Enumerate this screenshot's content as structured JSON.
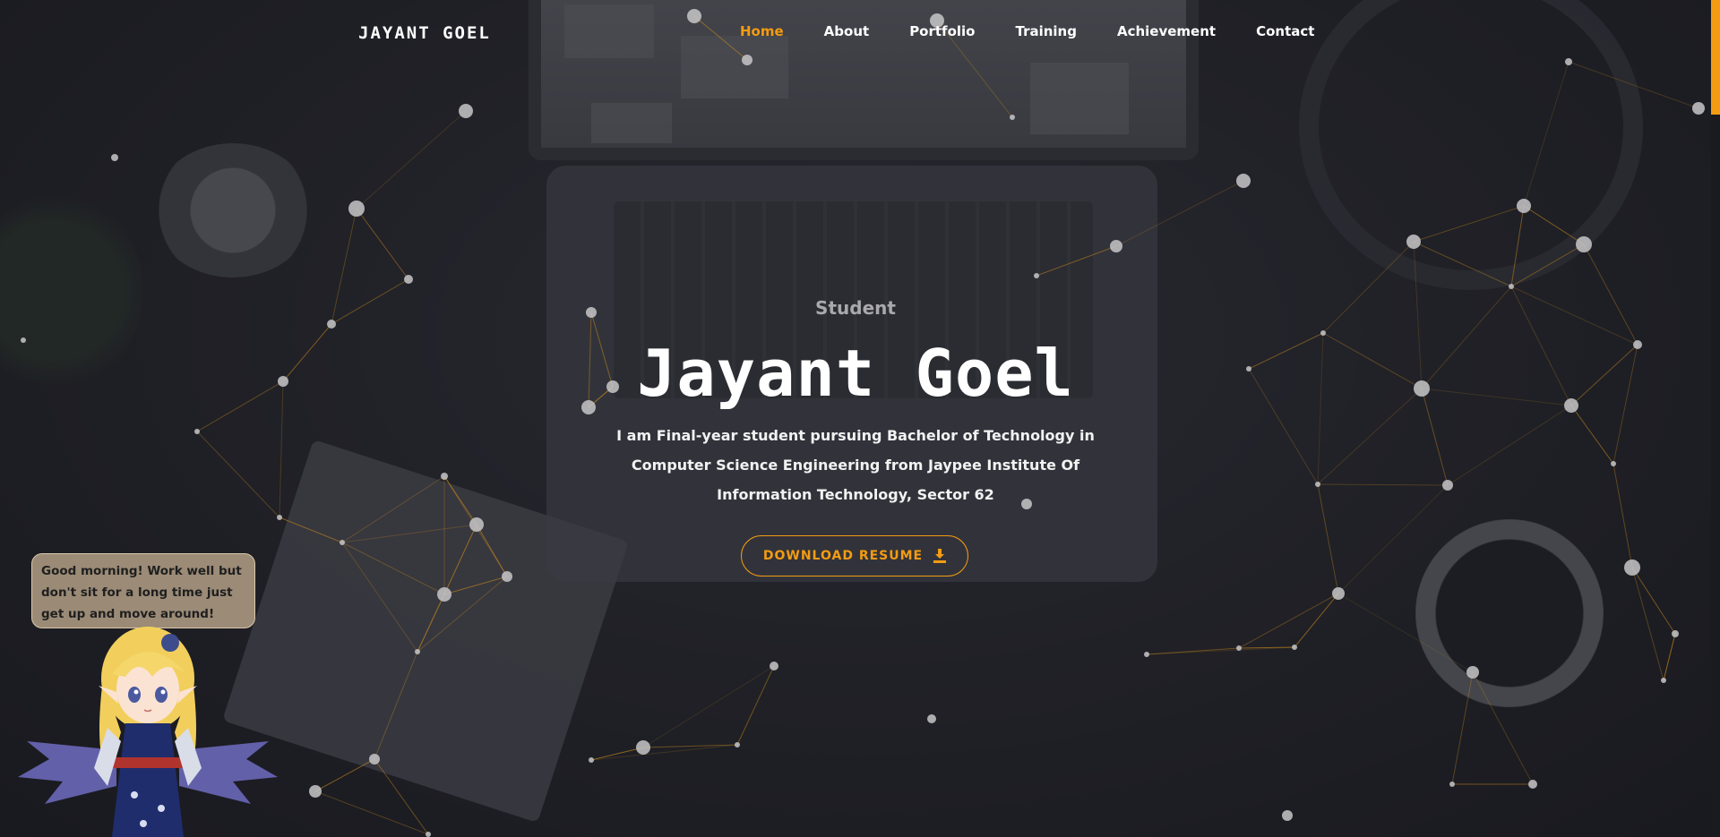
{
  "header": {
    "logo": "JAYANT GOEL",
    "nav": [
      {
        "label": "Home",
        "active": true
      },
      {
        "label": "About"
      },
      {
        "label": "Portfolio"
      },
      {
        "label": "Training"
      },
      {
        "label": "Achievement"
      },
      {
        "label": "Contact"
      }
    ]
  },
  "hero": {
    "eyebrow": "Student",
    "title": "Jayant Goel",
    "description": "I am Final-year student pursuing Bachelor of Technology in Computer Science Engineering from Jaypee Institute Of Information Technology, Sector 62",
    "resume_button": "DOWNLOAD RESUME",
    "resume_icon": "download-icon"
  },
  "mascot": {
    "message": "Good morning! Work well but don't sit for a long time just get up and move around!"
  },
  "colors": {
    "accent": "#f39c12",
    "text": "#ffffff",
    "background": "#23242a",
    "network_line": "#c98a1e",
    "network_node": "#c7c7c9"
  }
}
